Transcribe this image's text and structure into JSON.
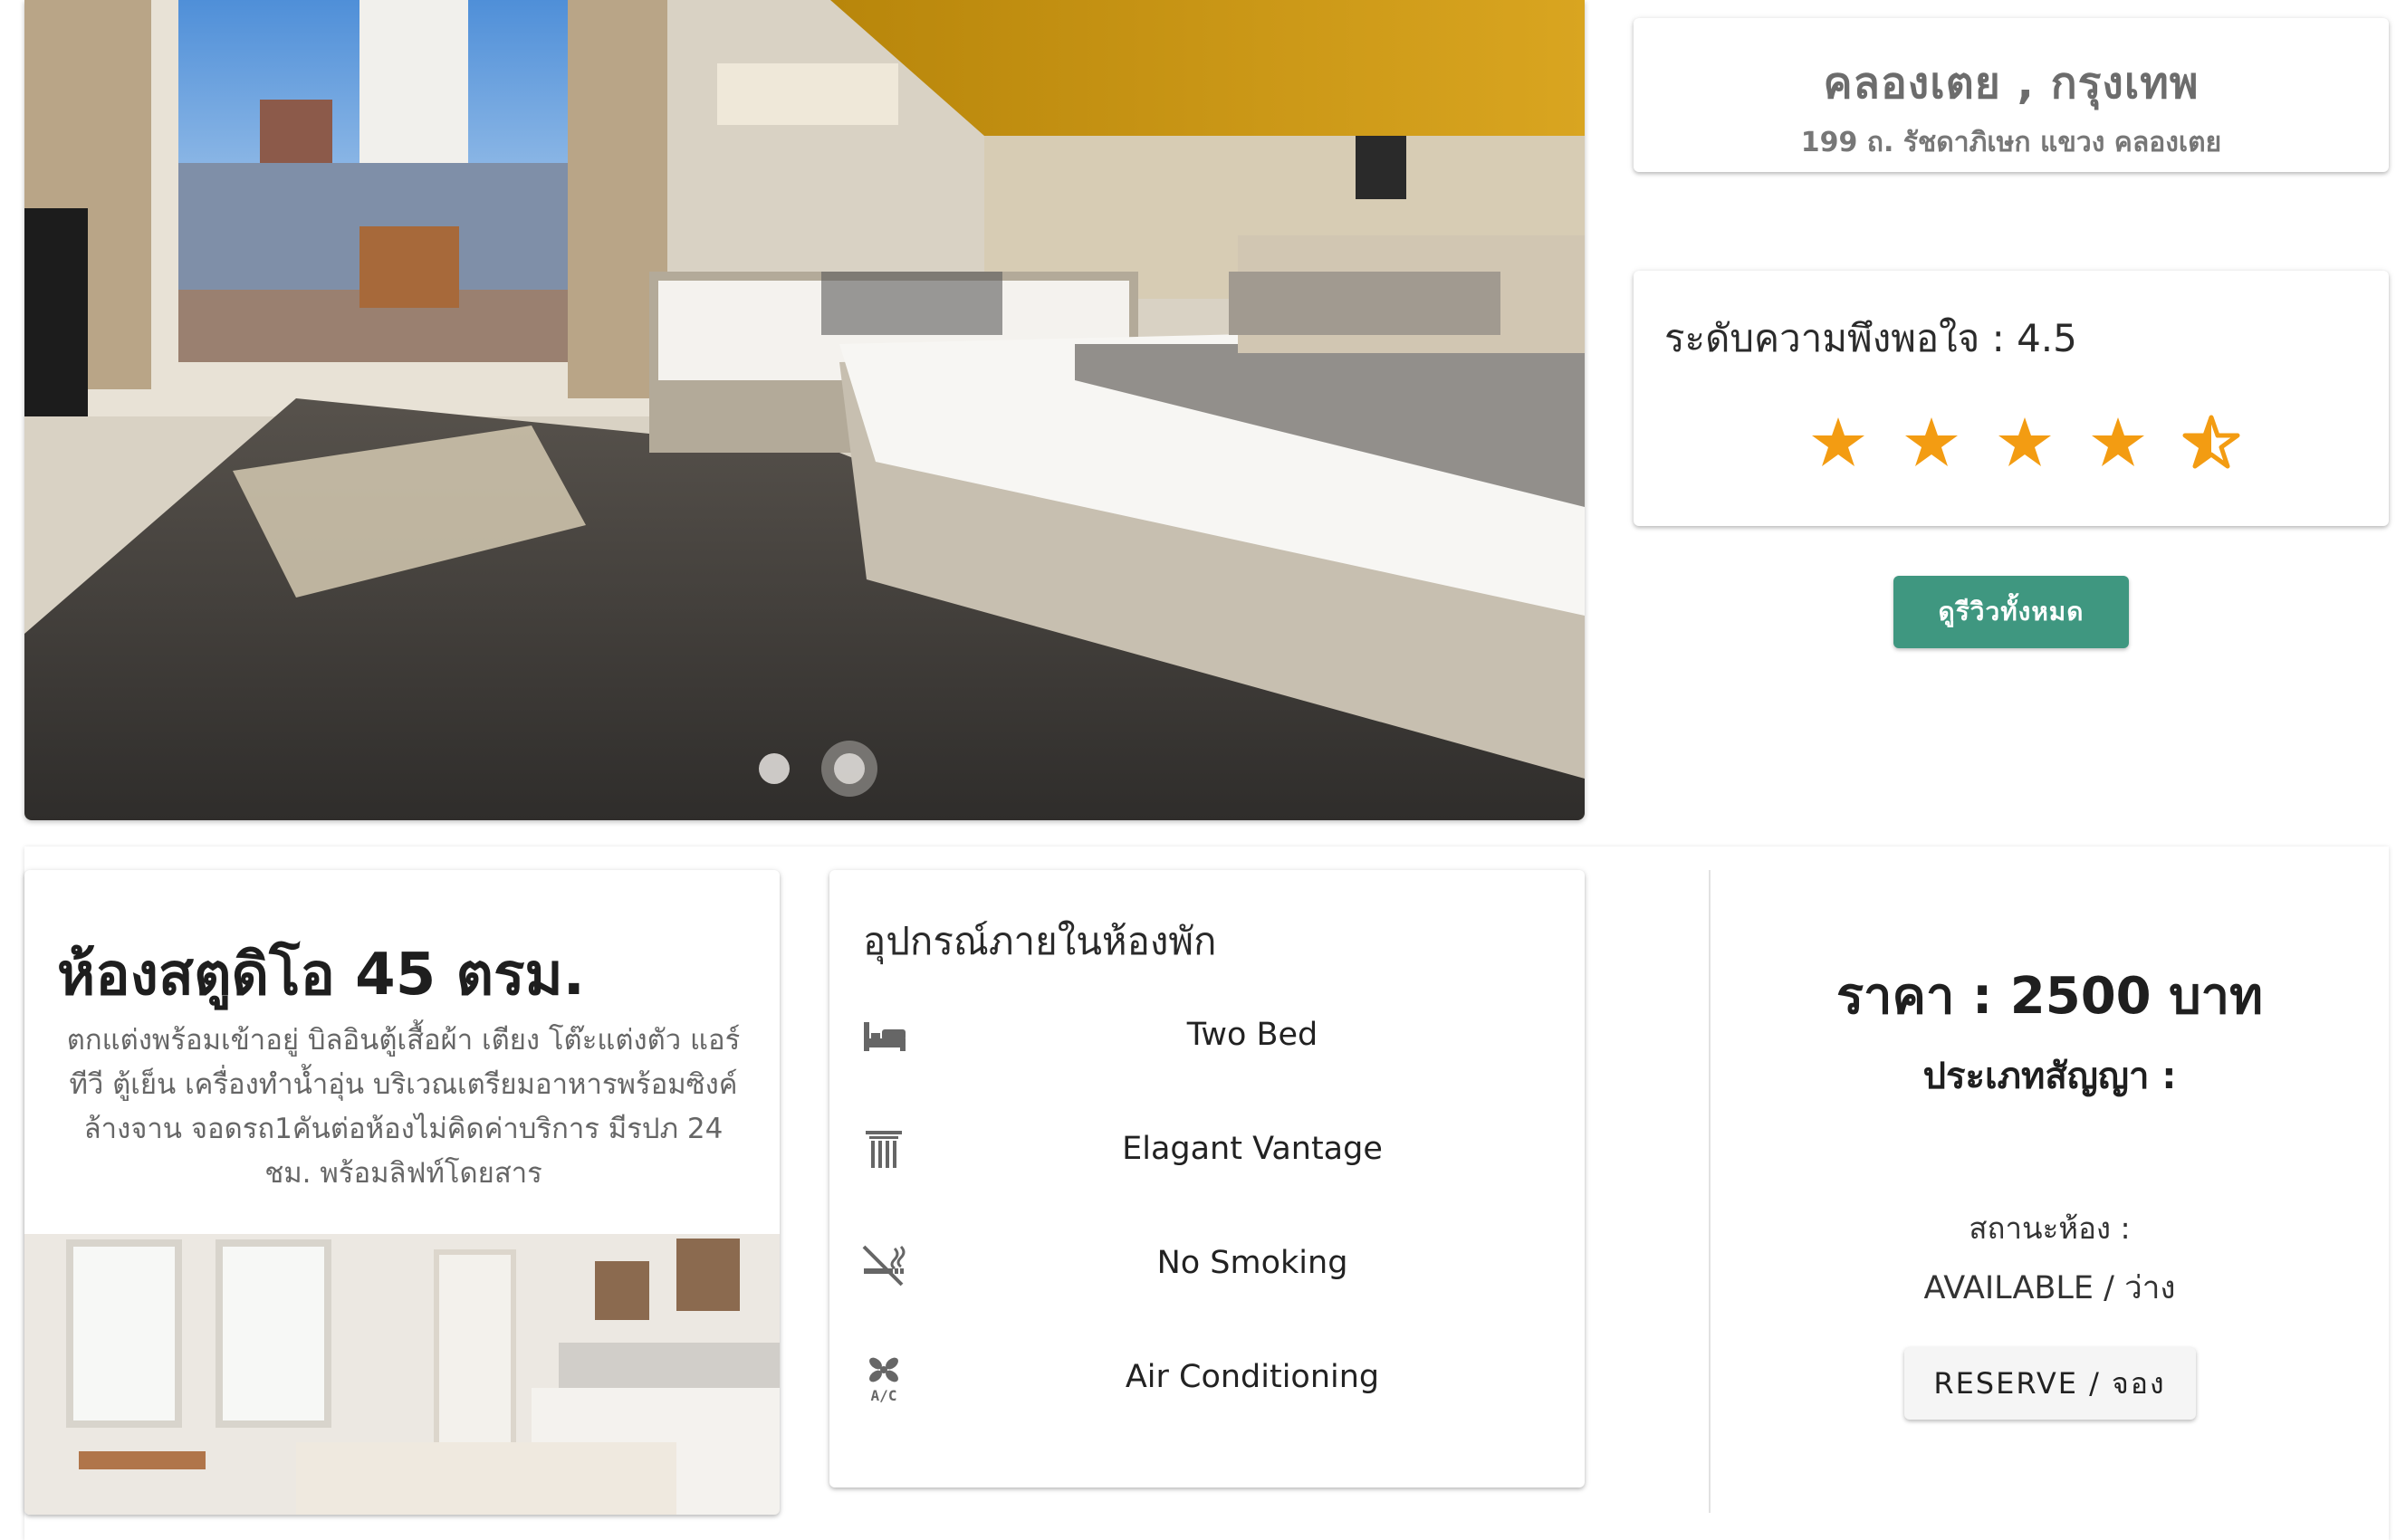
{
  "carousel": {
    "slides": 2,
    "active_index": 1
  },
  "location": {
    "city": "คลองเตย , กรุงเทพ",
    "address": "199 ถ. รัชดาภิเษก แขวง คลองเตย"
  },
  "rating": {
    "label": "ระดับความพึงพอใจ : 4.5",
    "value": 4.5,
    "max": 5,
    "star_color": "#f39c12"
  },
  "review_button": {
    "label": "ดูรีวิวทั้งหมด",
    "color": "#3f9780"
  },
  "room": {
    "title": "ห้องสตูดิโอ 45 ตรม.",
    "description": "ตกแต่งพร้อมเข้าอยู่ บิลอินตู้เสื้อผ้า เตียง โต๊ะแต่งตัว แอร์ ทีวี ตู้เย็น เครื่องทำน้ำอุ่น บริเวณเตรียมอาหารพร้อมซิงค์ล้างจาน จอดรถ1คันต่อห้องไม่คิดค่าบริการ มีรปภ 24 ชม. พร้อมลิฟท์โดยสาร"
  },
  "amenities": {
    "heading": "อุปกรณ์ภายในห้องพัก",
    "items": [
      {
        "icon": "bed-icon",
        "label": "Two Bed"
      },
      {
        "icon": "column-icon",
        "label": "Elagant Vantage"
      },
      {
        "icon": "no-smoking-icon",
        "label": "No Smoking"
      },
      {
        "icon": "air-conditioning-icon",
        "label": "Air Conditioning"
      }
    ]
  },
  "booking": {
    "price": "ราคา : 2500 บาท",
    "contract": "ประเภทสัญญา :",
    "status_label": "สถานะห้อง :",
    "status_value": "AVAILABLE / ว่าง",
    "reserve_label": "RESERVE / จอง"
  }
}
